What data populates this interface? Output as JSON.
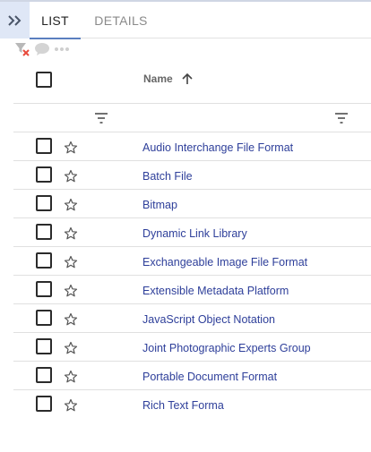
{
  "tabs": [
    {
      "label": "LIST",
      "active": true
    },
    {
      "label": "DETAILS",
      "active": false
    }
  ],
  "table": {
    "column_header": "Name",
    "sort_direction": "ascending",
    "rows": [
      {
        "name": "Audio Interchange File Format"
      },
      {
        "name": "Batch File"
      },
      {
        "name": "Bitmap"
      },
      {
        "name": "Dynamic Link Library"
      },
      {
        "name": "Exchangeable Image File Format"
      },
      {
        "name": "Extensible Metadata Platform"
      },
      {
        "name": "JavaScript Object Notation"
      },
      {
        "name": "Joint Photographic Experts Group"
      },
      {
        "name": "Portable Document Format"
      },
      {
        "name": "Rich Text Forma"
      }
    ]
  },
  "colors": {
    "accent": "#5b7fbf",
    "link": "#2e3f9a",
    "expand_bg": "#dfe7f6",
    "clear_filter_x": "#e84a3c"
  },
  "icons": [
    "expand-double-chevron",
    "clear-filter",
    "comment",
    "more-dots",
    "sort-arrow-up",
    "column-filter",
    "star-outline"
  ]
}
